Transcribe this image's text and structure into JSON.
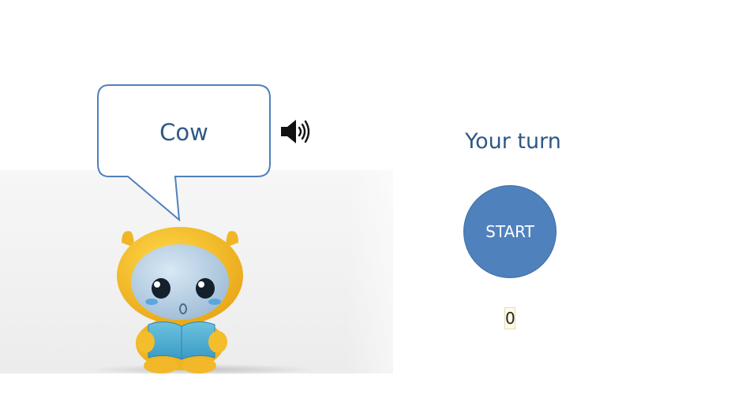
{
  "speech_bubble": {
    "word": "Cow"
  },
  "audio": {
    "icon": "speaker-icon"
  },
  "turn": {
    "label": "Your turn"
  },
  "start_button": {
    "label": "START"
  },
  "counter": {
    "value": "0"
  },
  "colors": {
    "accent_text": "#2f5886",
    "button_fill": "#4f81bd",
    "bubble_stroke": "#4f81bd",
    "robot_yellow": "#f3c12f"
  }
}
